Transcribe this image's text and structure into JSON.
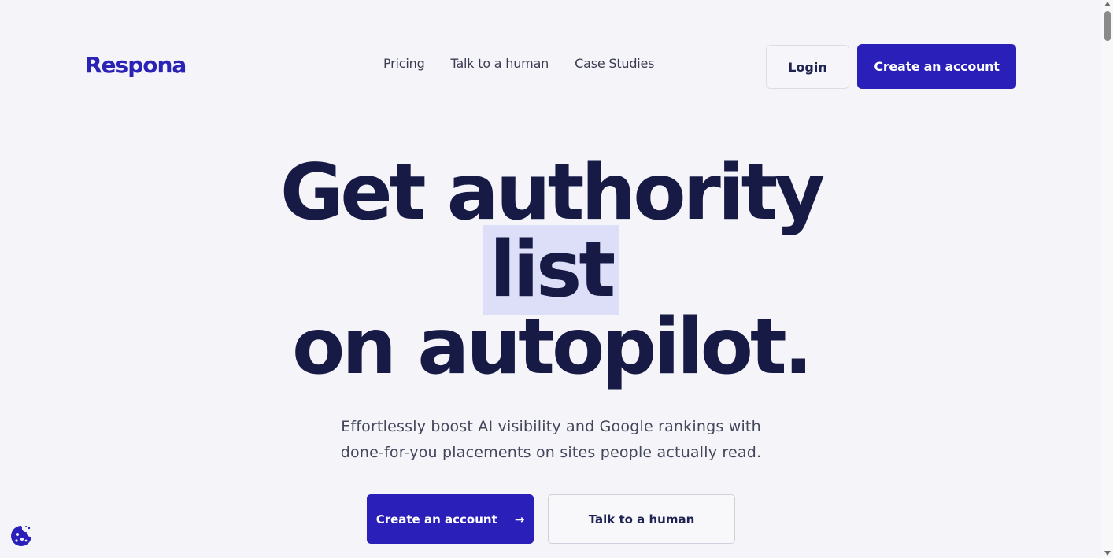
{
  "header": {
    "logo": "Respona",
    "nav": [
      {
        "label": "Pricing"
      },
      {
        "label": "Talk to a human"
      },
      {
        "label": "Case Studies"
      }
    ],
    "login_label": "Login",
    "create_label": "Create an account"
  },
  "hero": {
    "line1": "Get authority",
    "line2": "list",
    "line3": "on autopilot.",
    "subtitle_line1": "Effortlessly boost AI visibility and Google rankings with",
    "subtitle_line2": "done-for-you placements on sites people actually read.",
    "cta_primary": "Create an account",
    "cta_primary_icon": "arrow-right-icon",
    "cta_secondary": "Talk to a human"
  },
  "colors": {
    "brand": "#2a1fb8",
    "heading": "#161a45",
    "highlight": "#dcdff7",
    "background": "#f4f4f9"
  },
  "widgets": {
    "cookie_icon": "cookie-icon"
  }
}
